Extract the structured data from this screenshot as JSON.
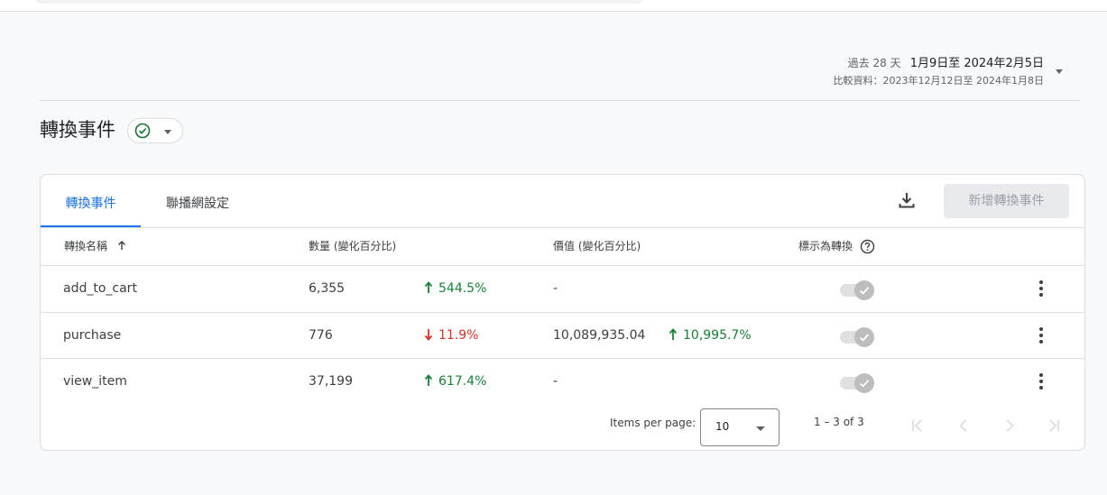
{
  "header": {
    "date_prefix": "過去 28 天",
    "date_range": "1月9日至 2024年2月5日",
    "compare_text": "比較資料：2023年12月12日至 2024年1月8日"
  },
  "page": {
    "title": "轉換事件",
    "status_icon": "check-circle-icon"
  },
  "tabs": [
    {
      "label": "轉換事件",
      "active": true
    },
    {
      "label": "聯播網設定",
      "active": false
    }
  ],
  "toolbar": {
    "download_icon": "download-icon",
    "new_button_label": "新增轉換事件"
  },
  "table": {
    "columns": {
      "name": "轉換名稱",
      "count": "數量 (變化百分比)",
      "value": "價值 (變化百分比)",
      "mark": "標示為轉換"
    },
    "rows": [
      {
        "name": "add_to_cart",
        "count": "6,355",
        "count_change": "544.5%",
        "count_dir": "up",
        "value": "-",
        "value_change": "",
        "value_dir": "",
        "marked": true
      },
      {
        "name": "purchase",
        "count": "776",
        "count_change": "11.9%",
        "count_dir": "down",
        "value": "10,089,935.04",
        "value_change": "10,995.7%",
        "value_dir": "up",
        "marked": true
      },
      {
        "name": "view_item",
        "count": "37,199",
        "count_change": "617.4%",
        "count_dir": "up",
        "value": "-",
        "value_change": "",
        "value_dir": "",
        "marked": true
      }
    ]
  },
  "pagination": {
    "items_per_page_label": "Items per page:",
    "items_per_page_value": "10",
    "range_text": "1 – 3 of 3"
  },
  "colors": {
    "accent": "#1a73e8",
    "up": "#188038",
    "down": "#d93025"
  }
}
